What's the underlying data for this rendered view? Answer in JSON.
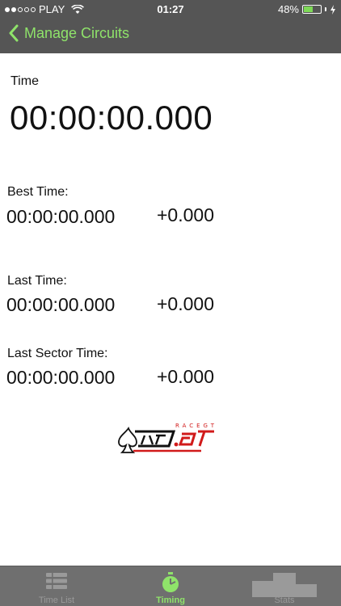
{
  "status_bar": {
    "carrier": "PLAY",
    "time": "01:27",
    "battery_percent": "48%",
    "battery_level": 0.48
  },
  "nav": {
    "back_label": "Manage Circuits"
  },
  "timer": {
    "label": "Time",
    "value": "00:00:00.000"
  },
  "sections": {
    "best": {
      "label": "Best Time:",
      "time": "00:00:00.000",
      "delta": "+0.000"
    },
    "last": {
      "label": "Last Time:",
      "time": "00:00:00.000",
      "delta": "+0.000"
    },
    "sector": {
      "label": "Last Sector Time:",
      "time": "00:00:00.000",
      "delta": "+0.000"
    }
  },
  "logo": {
    "text": "RACE.GT"
  },
  "tabs": [
    {
      "label": "Time List",
      "icon": "list-icon"
    },
    {
      "label": "Timing",
      "icon": "stopwatch-icon"
    },
    {
      "label": "Stats",
      "icon": "podium-icon"
    }
  ],
  "colors": {
    "accent": "#8fe36a",
    "bar": "#555555",
    "tabbar": "#6f6f6f"
  }
}
